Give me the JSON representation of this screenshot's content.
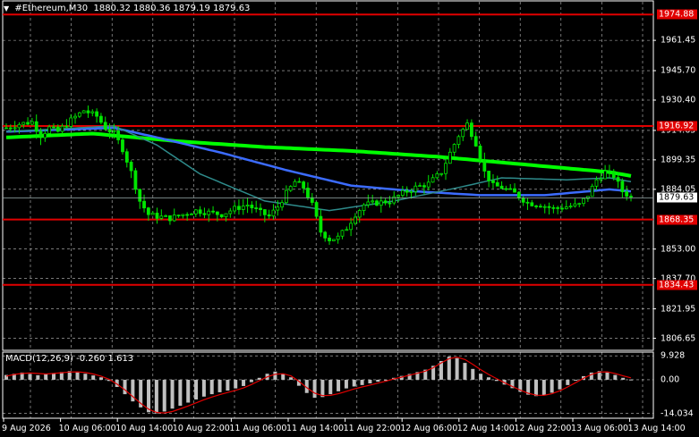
{
  "header": {
    "symbol": "#Ethereum,M30",
    "ohlc": "1880.32 1880.36 1879.19 1879.63"
  },
  "macd_header": "MACD(12,26,9) -0.260 1.613",
  "price_axis": {
    "ticks": [
      "1961.45",
      "1945.70",
      "1930.40",
      "1914.65",
      "1899.35",
      "1884.05",
      "1853.00",
      "1837.70",
      "1821.95",
      "1806.65"
    ],
    "range": [
      1800.4,
      1982.4
    ]
  },
  "macd_axis": {
    "ticks": [
      "9.928",
      "0.00",
      "-14.034"
    ],
    "range": [
      -16,
      11.5
    ]
  },
  "levels": [
    {
      "label": "1974.88",
      "value": 1974.88
    },
    {
      "label": "1916.92",
      "value": 1916.92
    },
    {
      "label": "1868.35",
      "value": 1868.35
    },
    {
      "label": "1834.43",
      "value": 1834.43
    }
  ],
  "current_price": {
    "label": "1879.63",
    "value": 1879.63
  },
  "time_axis": [
    "9 Aug 2026",
    "10 Aug 06:00",
    "10 Aug 14:00",
    "10 Aug 22:00",
    "11 Aug 06:00",
    "11 Aug 14:00",
    "11 Aug 22:00",
    "12 Aug 06:00",
    "12 Aug 14:00",
    "12 Aug 22:00",
    "13 Aug 06:00",
    "13 Aug 14:00"
  ],
  "colors": {
    "background": "#000000",
    "candles": "#00e600",
    "level_lines": "#e10000",
    "ma_slow": "#00ff00",
    "ma_mid": "#3c6cff",
    "ma_fast": "#2e8b8b",
    "macd_hist": "#c0c0c0",
    "macd_signal": "#e10000",
    "grid": "#ffffff"
  },
  "chart_data": {
    "type": "line",
    "price_series": [
      {
        "t": 0,
        "p": 1916
      },
      {
        "t": 3,
        "p": 1918
      },
      {
        "t": 6,
        "p": 1919
      },
      {
        "t": 8,
        "p": 1912
      },
      {
        "t": 10,
        "p": 1916
      },
      {
        "t": 12,
        "p": 1914
      },
      {
        "t": 15,
        "p": 1920
      },
      {
        "t": 18,
        "p": 1925
      },
      {
        "t": 21,
        "p": 1922
      },
      {
        "t": 23,
        "p": 1916
      },
      {
        "t": 25,
        "p": 1913
      },
      {
        "t": 27,
        "p": 1905
      },
      {
        "t": 29,
        "p": 1893
      },
      {
        "t": 31,
        "p": 1878
      },
      {
        "t": 33,
        "p": 1871
      },
      {
        "t": 35,
        "p": 1870
      },
      {
        "t": 38,
        "p": 1869
      },
      {
        "t": 41,
        "p": 1871
      },
      {
        "t": 44,
        "p": 1873
      },
      {
        "t": 47,
        "p": 1872
      },
      {
        "t": 50,
        "p": 1871
      },
      {
        "t": 53,
        "p": 1874
      },
      {
        "t": 56,
        "p": 1876
      },
      {
        "t": 59,
        "p": 1872
      },
      {
        "t": 61,
        "p": 1870
      },
      {
        "t": 63,
        "p": 1875
      },
      {
        "t": 65,
        "p": 1882
      },
      {
        "t": 67,
        "p": 1888
      },
      {
        "t": 69,
        "p": 1885
      },
      {
        "t": 71,
        "p": 1876
      },
      {
        "t": 73,
        "p": 1862
      },
      {
        "t": 75,
        "p": 1858
      },
      {
        "t": 77,
        "p": 1859
      },
      {
        "t": 79,
        "p": 1864
      },
      {
        "t": 81,
        "p": 1871
      },
      {
        "t": 83,
        "p": 1876
      },
      {
        "t": 86,
        "p": 1877
      },
      {
        "t": 89,
        "p": 1878
      },
      {
        "t": 92,
        "p": 1882
      },
      {
        "t": 95,
        "p": 1885
      },
      {
        "t": 98,
        "p": 1887
      },
      {
        "t": 101,
        "p": 1893
      },
      {
        "t": 103,
        "p": 1903
      },
      {
        "t": 105,
        "p": 1912
      },
      {
        "t": 107,
        "p": 1918
      },
      {
        "t": 109,
        "p": 1908
      },
      {
        "t": 111,
        "p": 1893
      },
      {
        "t": 113,
        "p": 1886
      },
      {
        "t": 115,
        "p": 1885
      },
      {
        "t": 118,
        "p": 1882
      },
      {
        "t": 121,
        "p": 1877
      },
      {
        "t": 124,
        "p": 1876
      },
      {
        "t": 127,
        "p": 1874
      },
      {
        "t": 130,
        "p": 1875
      },
      {
        "t": 133,
        "p": 1876
      },
      {
        "t": 135,
        "p": 1881
      },
      {
        "t": 137,
        "p": 1889
      },
      {
        "t": 139,
        "p": 1893
      },
      {
        "t": 141,
        "p": 1891
      },
      {
        "t": 143,
        "p": 1883
      },
      {
        "t": 145,
        "p": 1880
      }
    ],
    "ma_slow": [
      {
        "t": 0,
        "p": 1911
      },
      {
        "t": 20,
        "p": 1913
      },
      {
        "t": 40,
        "p": 1909
      },
      {
        "t": 60,
        "p": 1906
      },
      {
        "t": 80,
        "p": 1904
      },
      {
        "t": 100,
        "p": 1901
      },
      {
        "t": 120,
        "p": 1897
      },
      {
        "t": 140,
        "p": 1893
      },
      {
        "t": 145,
        "p": 1891
      }
    ],
    "ma_mid": [
      {
        "t": 0,
        "p": 1914
      },
      {
        "t": 25,
        "p": 1916
      },
      {
        "t": 35,
        "p": 1911
      },
      {
        "t": 50,
        "p": 1903
      },
      {
        "t": 65,
        "p": 1894
      },
      {
        "t": 80,
        "p": 1886
      },
      {
        "t": 95,
        "p": 1883
      },
      {
        "t": 110,
        "p": 1881
      },
      {
        "t": 125,
        "p": 1881
      },
      {
        "t": 140,
        "p": 1884
      },
      {
        "t": 145,
        "p": 1883
      }
    ],
    "ma_fast": [
      {
        "t": 0,
        "p": 1914
      },
      {
        "t": 25,
        "p": 1917
      },
      {
        "t": 35,
        "p": 1907
      },
      {
        "t": 45,
        "p": 1892
      },
      {
        "t": 60,
        "p": 1878
      },
      {
        "t": 75,
        "p": 1873
      },
      {
        "t": 90,
        "p": 1878
      },
      {
        "t": 105,
        "p": 1885
      },
      {
        "t": 115,
        "p": 1890
      },
      {
        "t": 130,
        "p": 1889
      },
      {
        "t": 140,
        "p": 1890
      },
      {
        "t": 145,
        "p": 1888
      }
    ],
    "macd_hist": [
      2.0,
      2.5,
      3.0,
      2.4,
      1.9,
      2.3,
      2.8,
      3.2,
      3.6,
      3.1,
      2.5,
      1.8,
      1.0,
      -0.5,
      -3.0,
      -6.0,
      -9.0,
      -11.5,
      -13.5,
      -14.0,
      -13.2,
      -12.0,
      -10.8,
      -9.5,
      -8.2,
      -7.0,
      -6.0,
      -5.2,
      -4.5,
      -3.6,
      -2.6,
      -1.0,
      0.8,
      2.5,
      3.4,
      2.6,
      1.0,
      -2.5,
      -5.5,
      -7.5,
      -7.2,
      -6.0,
      -4.8,
      -3.6,
      -2.8,
      -2.2,
      -1.5,
      -0.8,
      0.0,
      0.8,
      1.6,
      2.4,
      3.2,
      4.2,
      5.8,
      7.8,
      9.6,
      9.0,
      7.0,
      4.5,
      2.5,
      1.0,
      -0.5,
      -2.0,
      -3.5,
      -5.0,
      -6.2,
      -6.8,
      -6.5,
      -5.4,
      -4.0,
      -2.2,
      -0.3,
      1.5,
      3.0,
      3.6,
      3.0,
      2.0,
      0.8,
      0.1
    ],
    "macd_signal": [
      1.5,
      2.2,
      2.6,
      2.8,
      2.6,
      2.4,
      2.6,
      2.9,
      3.2,
      3.3,
      3.0,
      2.4,
      1.5,
      0.2,
      -1.8,
      -4.2,
      -7.0,
      -9.8,
      -12.2,
      -13.6,
      -13.8,
      -13.2,
      -12.1,
      -10.9,
      -9.6,
      -8.3,
      -7.2,
      -6.2,
      -5.3,
      -4.4,
      -3.4,
      -2.0,
      -0.4,
      1.2,
      2.3,
      2.5,
      1.6,
      -0.6,
      -3.3,
      -5.6,
      -6.6,
      -6.5,
      -5.8,
      -4.8,
      -3.8,
      -3.0,
      -2.2,
      -1.4,
      -0.6,
      0.3,
      1.1,
      1.9,
      2.7,
      3.6,
      5.0,
      7.0,
      8.8,
      9.4,
      8.4,
      6.4,
      4.2,
      2.2,
      0.5,
      -1.2,
      -2.8,
      -4.3,
      -5.6,
      -6.4,
      -6.5,
      -5.8,
      -4.6,
      -3.0,
      -1.2,
      0.6,
      2.2,
      3.2,
      3.3,
      2.6,
      1.6,
      0.8
    ]
  }
}
